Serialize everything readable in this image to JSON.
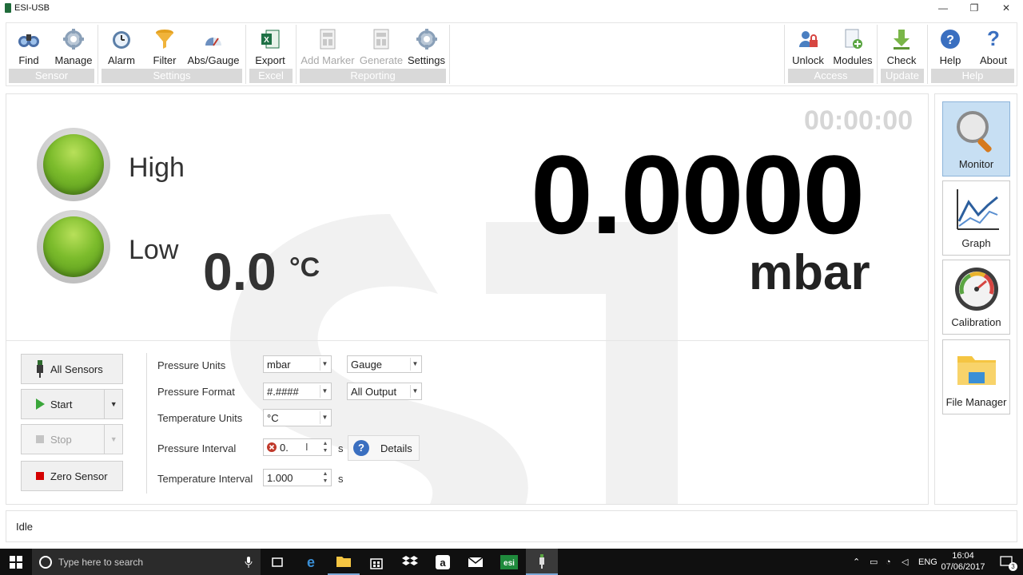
{
  "window": {
    "title": "ESI-USB",
    "minimize": "—",
    "restore": "❐",
    "close": "✕"
  },
  "ribbon": {
    "groups": [
      {
        "label": "Sensor",
        "buttons": [
          {
            "label": "Find",
            "icon": "binoculars-icon"
          },
          {
            "label": "Manage",
            "icon": "gear-icon"
          }
        ]
      },
      {
        "label": "Settings",
        "buttons": [
          {
            "label": "Alarm",
            "icon": "alarm-clock-icon"
          },
          {
            "label": "Filter",
            "icon": "funnel-icon"
          },
          {
            "label": "Abs/Gauge",
            "icon": "abs-gauge-icon"
          }
        ]
      },
      {
        "label": "Excel",
        "buttons": [
          {
            "label": "Export",
            "icon": "excel-icon"
          }
        ]
      },
      {
        "label": "Reporting",
        "buttons": [
          {
            "label": "Add Marker",
            "icon": "report-icon",
            "disabled": true
          },
          {
            "label": "Generate",
            "icon": "report-icon",
            "disabled": true
          },
          {
            "label": "Settings",
            "icon": "gear-icon"
          }
        ]
      },
      {
        "label": "Access",
        "buttons": [
          {
            "label": "Unlock",
            "icon": "users-lock-icon"
          },
          {
            "label": "Modules",
            "icon": "document-add-icon"
          }
        ]
      },
      {
        "label": "Update",
        "buttons": [
          {
            "label": "Check",
            "icon": "download-arrow-icon"
          }
        ]
      },
      {
        "label": "Help",
        "buttons": [
          {
            "label": "Help",
            "icon": "help-icon"
          },
          {
            "label": "About",
            "icon": "question-icon"
          }
        ]
      }
    ]
  },
  "monitor": {
    "timer": "00:00:00",
    "alarm_high_label": "High",
    "alarm_low_label": "Low",
    "pressure_value": "0.0000",
    "pressure_unit": "mbar",
    "temperature_value": "0.0",
    "temperature_unit": "°C"
  },
  "actions": {
    "all_sensors": "All Sensors",
    "start": "Start",
    "stop": "Stop",
    "zero_sensor": "Zero Sensor"
  },
  "form": {
    "pressure_units_label": "Pressure Units",
    "pressure_units_value": "mbar",
    "pressure_mode_value": "Gauge",
    "pressure_format_label": "Pressure Format",
    "pressure_format_value": "#.####",
    "output_value": "All Output",
    "temperature_units_label": "Temperature Units",
    "temperature_units_value": "°C",
    "pressure_interval_label": "Pressure Interval",
    "pressure_interval_value": "0.",
    "pressure_interval_unit": "s",
    "details_label": "Details",
    "temperature_interval_label": "Temperature Interval",
    "temperature_interval_value": "1.000",
    "temperature_interval_unit": "s"
  },
  "side_nav": [
    {
      "label": "Monitor",
      "icon": "magnifier-icon",
      "active": true
    },
    {
      "label": "Graph",
      "icon": "line-graph-icon",
      "active": false
    },
    {
      "label": "Calibration",
      "icon": "gauge-dial-icon",
      "active": false
    },
    {
      "label": "File Manager",
      "icon": "folder-icon",
      "active": false
    }
  ],
  "status": {
    "text": "Idle"
  },
  "taskbar": {
    "search_placeholder": "Type here to search",
    "language": "ENG",
    "time": "16:04",
    "date": "07/06/2017",
    "notification_count": "3"
  },
  "colors": {
    "accent": "#c7dff3",
    "led_green": "#7cbc2c",
    "group_label_bg": "#d9d9d9",
    "stop_red": "#d40000",
    "start_green": "#3aa63a"
  }
}
